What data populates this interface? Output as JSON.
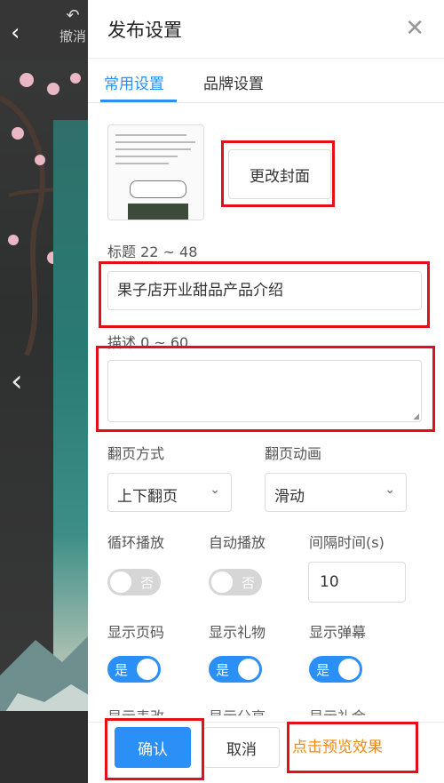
{
  "editor": {
    "undo_label": "撤消",
    "icons": [
      "back-arrow-icon",
      "undo-icon",
      "prev-page-icon"
    ]
  },
  "dialog": {
    "title": "发布设置",
    "tabs": [
      {
        "label": "常用设置",
        "active": true
      },
      {
        "label": "品牌设置",
        "active": false
      }
    ],
    "cover": {
      "change_label": "更改封面"
    },
    "title_field": {
      "label": "标题 22 ~ 48",
      "value": "果子店开业甜品产品介绍"
    },
    "desc_field": {
      "label": "描述 0 ~ 60",
      "value": ""
    },
    "page_mode": {
      "label": "翻页方式",
      "selected": "上下翻页"
    },
    "page_anim": {
      "label": "翻页动画",
      "selected": "滑动"
    },
    "loop": {
      "label": "循环播放",
      "state": "否"
    },
    "autoplay": {
      "label": "自动播放",
      "state": "否"
    },
    "interval": {
      "label": "间隔时间(s)",
      "value": "10"
    },
    "show_page_num": {
      "label": "显示页码",
      "state": "是"
    },
    "show_gift": {
      "label": "显示礼物",
      "state": "是"
    },
    "show_danmaku": {
      "label": "显示弹幕",
      "state": "是"
    },
    "cut_labels": [
      "显示表改",
      "显示分享",
      "显示礼金"
    ],
    "footer": {
      "confirm": "确认",
      "cancel": "取消",
      "preview": "点击预览效果"
    }
  },
  "colors": {
    "accent": "#2a8ff7",
    "preview_link": "#f08a1a",
    "annotation": "#e3101b"
  }
}
